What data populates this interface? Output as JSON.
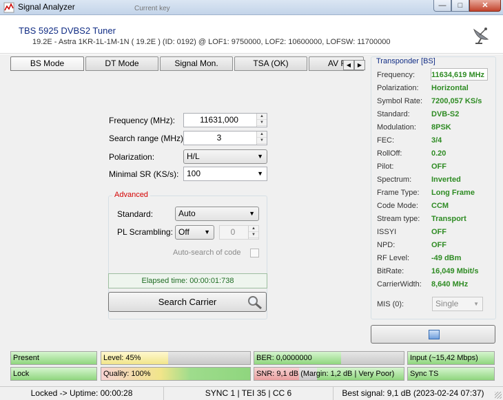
{
  "window": {
    "title": "Signal Analyzer",
    "background_text": "Current key"
  },
  "header": {
    "tuner": "TBS 5925 DVBS2 Tuner",
    "info": "19.2E - Astra 1KR-1L-1M-1N ( 19.2E ) (ID: 0192) @ LOF1: 9750000, LOF2: 10600000, LOFSW: 11700000"
  },
  "tabs": [
    "BS Mode",
    "DT Mode",
    "Signal Mon.",
    "TSA (OK)",
    "AV Fo"
  ],
  "form": {
    "frequency_label": "Frequency (MHz):",
    "frequency_value": "11631,000",
    "range_label": "Search range (MHz):",
    "range_value": "3",
    "polarization_label": "Polarization:",
    "polarization_value": "H/L",
    "minsr_label": "Minimal SR (KS/s):",
    "minsr_value": "100"
  },
  "advanced": {
    "title": "Advanced",
    "standard_label": "Standard:",
    "standard_value": "Auto",
    "pl_label": "PL Scrambling:",
    "pl_value": "Off",
    "pl_code": "0",
    "autosearch_label": "Auto-search of code"
  },
  "elapsed": "Elapsed time: 00:00:01:738",
  "search_button": "Search Carrier",
  "transponder": {
    "title": "Transponder [BS]",
    "rows": [
      {
        "k": "Frequency:",
        "v": "11634,619 MHz"
      },
      {
        "k": "Polarization:",
        "v": "Horizontal"
      },
      {
        "k": "Symbol Rate:",
        "v": "7200,057 KS/s"
      },
      {
        "k": "Standard:",
        "v": "DVB-S2"
      },
      {
        "k": "Modulation:",
        "v": "8PSK"
      },
      {
        "k": "FEC:",
        "v": "3/4"
      },
      {
        "k": "RollOff:",
        "v": "0.20"
      },
      {
        "k": "Pilot:",
        "v": "OFF"
      },
      {
        "k": "Spectrum:",
        "v": "Inverted"
      },
      {
        "k": "Frame Type:",
        "v": "Long Frame"
      },
      {
        "k": "Code Mode:",
        "v": "CCM"
      },
      {
        "k": "Stream type:",
        "v": "Transport"
      },
      {
        "k": "ISSYI",
        "v": "OFF"
      },
      {
        "k": "NPD:",
        "v": "OFF"
      },
      {
        "k": "RF Level:",
        "v": "-49 dBm"
      },
      {
        "k": "BitRate:",
        "v": "16,049 Mbit/s"
      },
      {
        "k": "CarrierWidth:",
        "v": "8,640 MHz"
      }
    ],
    "mis_label": "MIS (0):",
    "mis_value": "Single"
  },
  "indicators": {
    "present": "Present",
    "level": {
      "text": "Level: 45%",
      "fraction": 0.45
    },
    "ber": {
      "text": "BER: 0,0000000",
      "fraction": 0.58
    },
    "input": "Input (~15,42 Mbps)",
    "lock": "Lock",
    "quality": {
      "text": "Quality: 100%",
      "fraction": 1.0
    },
    "snr": {
      "text": "SNR: 9,1 dB (Margin: 1,2 dB | Very Poor)",
      "fraction": 0.3
    },
    "sync": "Sync TS"
  },
  "statusbar": {
    "uptime": "Locked -> Uptime: 00:00:28",
    "sync": "SYNC 1 | TEI 35 | CC 6",
    "best": "Best signal: 9,1 dB (2023-02-24 07:37)"
  },
  "colors": {
    "accent": "#102c84",
    "value_green": "#2e8b23",
    "alert_red": "#d40000"
  }
}
